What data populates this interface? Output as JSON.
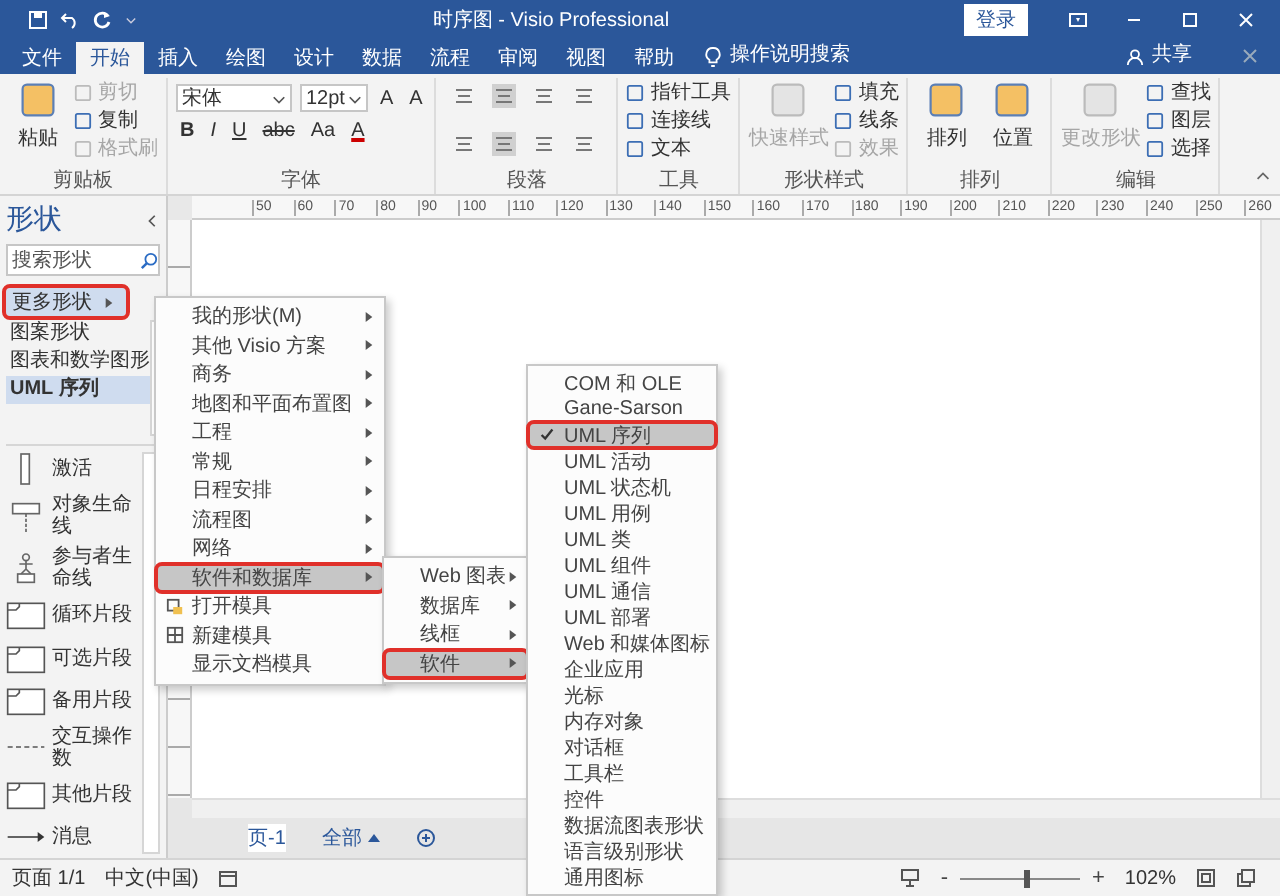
{
  "window": {
    "title": "时序图 - Visio Professional",
    "sign_in": "登录"
  },
  "ribbon_tabs": [
    {
      "label": "文件",
      "selected": false
    },
    {
      "label": "开始",
      "selected": true
    },
    {
      "label": "插入",
      "selected": false
    },
    {
      "label": "绘图",
      "selected": false
    },
    {
      "label": "设计",
      "selected": false
    },
    {
      "label": "数据",
      "selected": false
    },
    {
      "label": "流程",
      "selected": false
    },
    {
      "label": "审阅",
      "selected": false
    },
    {
      "label": "视图",
      "selected": false
    },
    {
      "label": "帮助",
      "selected": false
    }
  ],
  "tell_me": "操作说明搜索",
  "share": "共享",
  "ribbon_groups": [
    {
      "kind": "buttons",
      "label": "剪贴板",
      "large": [
        {
          "label": "粘贴",
          "disabled": false
        }
      ],
      "small": [
        {
          "label": "剪切",
          "disabled": true
        },
        {
          "label": "复制",
          "disabled": false
        },
        {
          "label": "格式刷",
          "disabled": true
        }
      ]
    },
    {
      "kind": "font",
      "label": "字体",
      "font": "宋体",
      "size": "12pt",
      "size_buttons": [
        "A",
        "A"
      ],
      "format_buttons": [
        "B",
        "I",
        "U",
        "abc",
        "Aa",
        "A"
      ]
    },
    {
      "kind": "paragraph",
      "label": "段落"
    },
    {
      "kind": "buttons",
      "label": "工具",
      "small": [
        {
          "label": "指针工具",
          "disabled": false
        },
        {
          "label": "连接线",
          "disabled": false
        },
        {
          "label": "文本",
          "disabled": false
        }
      ]
    },
    {
      "kind": "buttons",
      "label": "形状样式",
      "large": [
        {
          "label": "快速样式",
          "disabled": true
        }
      ],
      "small": [
        {
          "label": "填充",
          "disabled": false
        },
        {
          "label": "线条",
          "disabled": false
        },
        {
          "label": "效果",
          "disabled": true
        }
      ]
    },
    {
      "kind": "buttons",
      "label": "排列",
      "large": [
        {
          "label": "排列",
          "disabled": false
        },
        {
          "label": "位置",
          "disabled": false
        }
      ]
    },
    {
      "kind": "buttons",
      "label": "编辑",
      "large": [
        {
          "label": "更改形状",
          "disabled": true
        }
      ],
      "small": [
        {
          "label": "查找",
          "disabled": false
        },
        {
          "label": "图层",
          "disabled": false
        },
        {
          "label": "选择",
          "disabled": false
        }
      ]
    }
  ],
  "shapes_panel": {
    "title": "形状",
    "search_placeholder": "搜索形状",
    "more_shapes": {
      "label": "更多形状",
      "open": true,
      "marked": true
    },
    "stencils": [
      {
        "label": "图案形状",
        "selected": false
      },
      {
        "label": "图表和数学图形",
        "selected": false
      },
      {
        "label": "UML 序列",
        "selected": true
      }
    ],
    "shapes": [
      {
        "label": "激活",
        "kind": "activation"
      },
      {
        "label": "对象生命线",
        "kind": "lifeline"
      },
      {
        "label": "参与者生命线",
        "kind": "actor"
      },
      {
        "label": "循环片段",
        "kind": "fragment"
      },
      {
        "label": "可选片段",
        "kind": "fragment"
      },
      {
        "label": "备用片段",
        "kind": "fragment"
      },
      {
        "label": "交互操作数",
        "kind": "operand"
      },
      {
        "label": "其他片段",
        "kind": "fragment"
      },
      {
        "label": "消息",
        "kind": "message"
      }
    ]
  },
  "canvas": {
    "ruler_labels": [
      "50",
      "60",
      "70",
      "80",
      "90",
      "100",
      "110",
      "120",
      "130",
      "140",
      "150",
      "160",
      "170",
      "180",
      "190",
      "200",
      "210",
      "220",
      "230",
      "240",
      "250",
      "260"
    ],
    "page_tabs": [
      {
        "label": "页-1",
        "kind": "page"
      },
      {
        "label": "全部",
        "kind": "all"
      }
    ]
  },
  "menus": [
    {
      "items": [
        {
          "label": "我的形状(M)",
          "kind": "submenu",
          "selected": false,
          "marked": false
        },
        {
          "label": "其他 Visio 方案",
          "kind": "submenu",
          "selected": false,
          "marked": false
        },
        {
          "label": "商务",
          "kind": "submenu",
          "selected": false,
          "marked": false
        },
        {
          "label": "地图和平面布置图",
          "kind": "submenu",
          "selected": false,
          "marked": false
        },
        {
          "label": "工程",
          "kind": "submenu",
          "selected": false,
          "marked": false
        },
        {
          "label": "常规",
          "kind": "submenu",
          "selected": false,
          "marked": false
        },
        {
          "label": "日程安排",
          "kind": "submenu",
          "selected": false,
          "marked": false
        },
        {
          "label": "流程图",
          "kind": "submenu",
          "selected": false,
          "marked": false
        },
        {
          "label": "网络",
          "kind": "submenu",
          "selected": false,
          "marked": false
        },
        {
          "label": "软件和数据库",
          "kind": "submenu",
          "selected": true,
          "marked": true
        },
        {
          "label": "打开模具",
          "kind": "open",
          "selected": false,
          "marked": false
        },
        {
          "label": "新建模具",
          "kind": "new",
          "selected": false,
          "marked": false
        },
        {
          "label": "显示文档模具",
          "kind": "plain",
          "selected": false,
          "marked": false
        }
      ]
    },
    {
      "items": [
        {
          "label": "Web 图表",
          "kind": "submenu",
          "selected": false,
          "marked": false
        },
        {
          "label": "数据库",
          "kind": "submenu",
          "selected": false,
          "marked": false
        },
        {
          "label": "线框",
          "kind": "submenu",
          "selected": false,
          "marked": false
        },
        {
          "label": "软件",
          "kind": "submenu",
          "selected": true,
          "marked": true
        }
      ]
    },
    {
      "items": [
        {
          "label": "COM 和 OLE",
          "kind": "plain",
          "selected": false,
          "marked": false,
          "checked": false
        },
        {
          "label": "Gane-Sarson",
          "kind": "plain",
          "selected": false,
          "marked": false,
          "checked": false
        },
        {
          "label": "UML 序列",
          "kind": "plain",
          "selected": true,
          "marked": true,
          "checked": true
        },
        {
          "label": "UML 活动",
          "kind": "plain",
          "selected": false,
          "marked": false,
          "checked": false
        },
        {
          "label": "UML 状态机",
          "kind": "plain",
          "selected": false,
          "marked": false,
          "checked": false
        },
        {
          "label": "UML 用例",
          "kind": "plain",
          "selected": false,
          "marked": false,
          "checked": false
        },
        {
          "label": "UML 类",
          "kind": "plain",
          "selected": false,
          "marked": false,
          "checked": false
        },
        {
          "label": "UML 组件",
          "kind": "plain",
          "selected": false,
          "marked": false,
          "checked": false
        },
        {
          "label": "UML 通信",
          "kind": "plain",
          "selected": false,
          "marked": false,
          "checked": false
        },
        {
          "label": "UML 部署",
          "kind": "plain",
          "selected": false,
          "marked": false,
          "checked": false
        },
        {
          "label": "Web 和媒体图标",
          "kind": "plain",
          "selected": false,
          "marked": false,
          "checked": false
        },
        {
          "label": "企业应用",
          "kind": "plain",
          "selected": false,
          "marked": false,
          "checked": false
        },
        {
          "label": "光标",
          "kind": "plain",
          "selected": false,
          "marked": false,
          "checked": false
        },
        {
          "label": "内存对象",
          "kind": "plain",
          "selected": false,
          "marked": false,
          "checked": false
        },
        {
          "label": "对话框",
          "kind": "plain",
          "selected": false,
          "marked": false,
          "checked": false
        },
        {
          "label": "工具栏",
          "kind": "plain",
          "selected": false,
          "marked": false,
          "checked": false
        },
        {
          "label": "控件",
          "kind": "plain",
          "selected": false,
          "marked": false,
          "checked": false
        },
        {
          "label": "数据流图表形状",
          "kind": "plain",
          "selected": false,
          "marked": false,
          "checked": false
        },
        {
          "label": "语言级别形状",
          "kind": "plain",
          "selected": false,
          "marked": false,
          "checked": false
        },
        {
          "label": "通用图标",
          "kind": "plain",
          "selected": false,
          "marked": false,
          "checked": false
        }
      ]
    }
  ],
  "status_bar": {
    "page": "页面 1/1",
    "language": "中文(中国)",
    "zoom_out": "-",
    "zoom_in": "+",
    "zoom": {
      "level": 0.55,
      "reading": "102%"
    }
  }
}
